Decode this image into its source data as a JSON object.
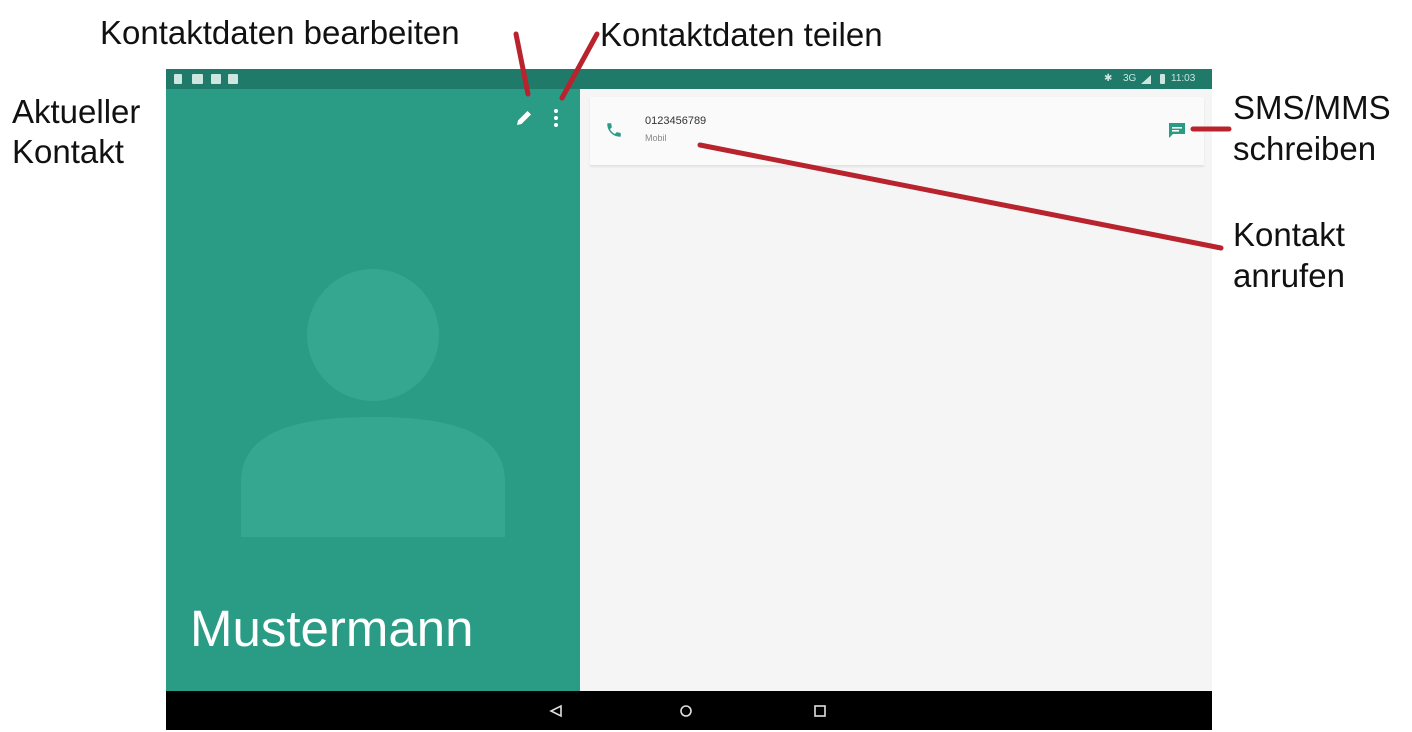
{
  "callouts": {
    "edit": "Kontaktdaten bearbeiten",
    "share": "Kontaktdaten teilen",
    "current_line1": "Aktueller",
    "current_line2": "Kontakt",
    "sms_line1": "SMS/MMS",
    "sms_line2": "schreiben",
    "call_line1": "Kontakt",
    "call_line2": "anrufen"
  },
  "status_bar": {
    "network": "3G",
    "time": "11:03"
  },
  "contact": {
    "name": "Mustermann",
    "phone_number": "0123456789",
    "phone_type": "Mobil"
  },
  "colors": {
    "accent": "#2a9b85",
    "status_bar": "#1f7a6a",
    "callout_line": "#b8232d"
  },
  "icons": {
    "edit": "pencil-icon",
    "share": "more-vert-icon",
    "call": "phone-icon",
    "message": "message-icon",
    "back": "back-triangle-icon",
    "home": "home-circle-icon",
    "recents": "recents-square-icon"
  }
}
